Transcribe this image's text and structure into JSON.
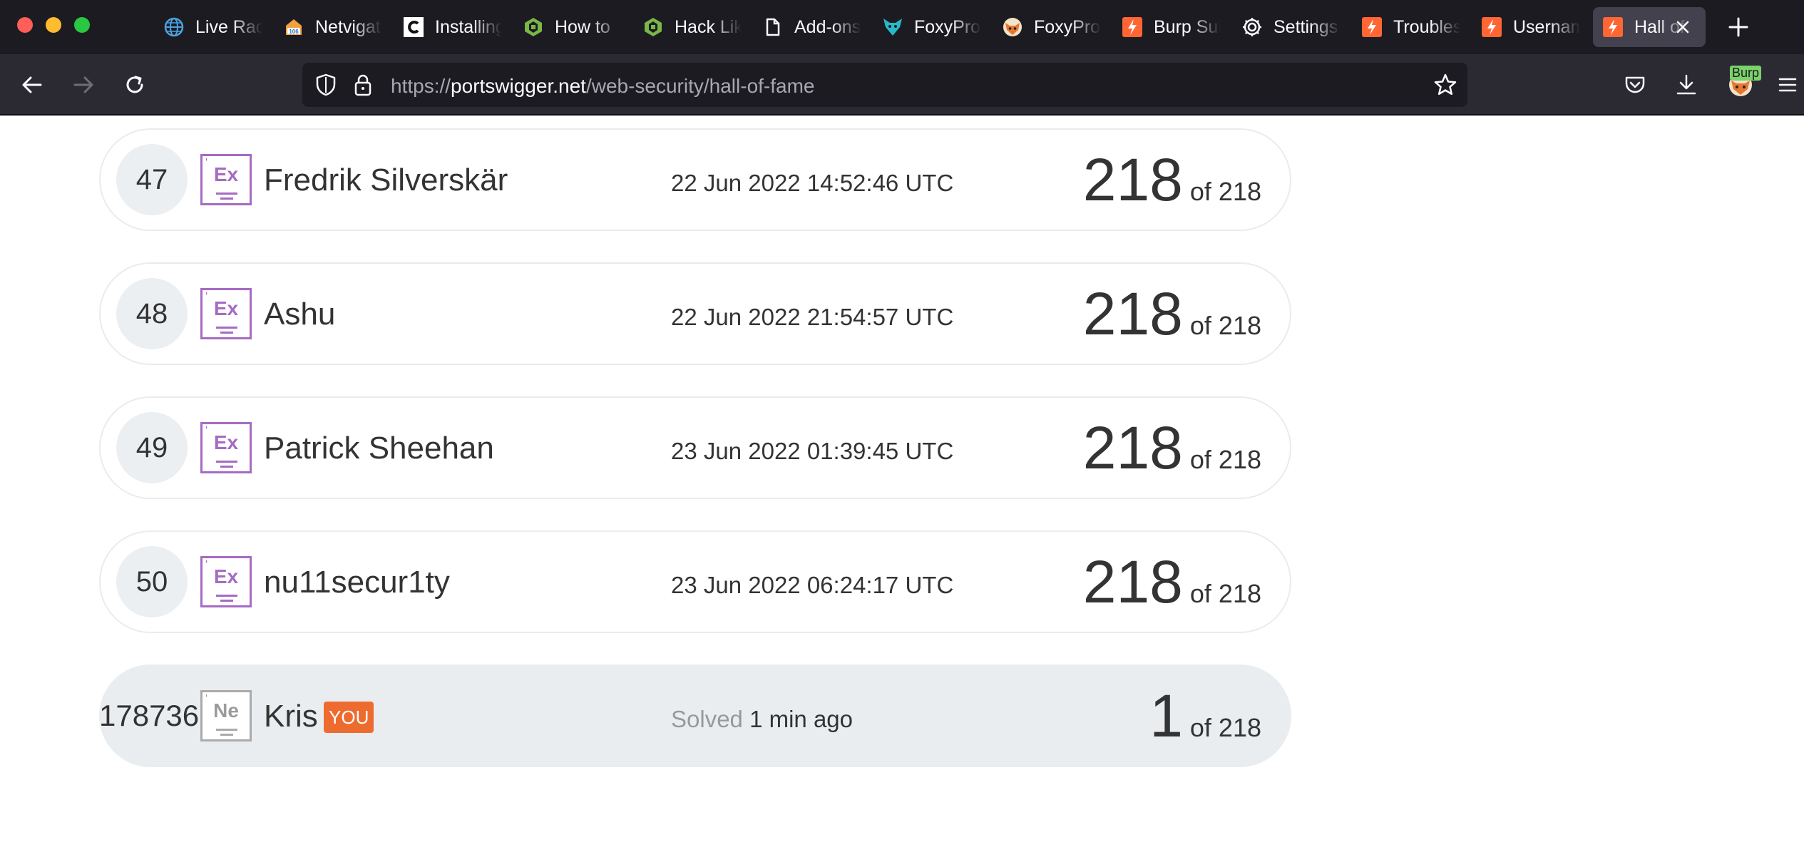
{
  "browser": {
    "tabs": [
      {
        "label": "Live Radar",
        "icon": "globe-icon"
      },
      {
        "label": "Netvigator",
        "icon": "netvigator-icon"
      },
      {
        "label": "Installing",
        "icon": "c-logo-icon"
      },
      {
        "label": "How to",
        "icon": "hack-logo-icon"
      },
      {
        "label": "Hack Like",
        "icon": "hack-logo-icon"
      },
      {
        "label": "Add-ons",
        "icon": "puzzle-icon"
      },
      {
        "label": "FoxyProxy",
        "icon": "foxyproxy-icon"
      },
      {
        "label": "FoxyProxy",
        "icon": "foxyproxy-fox-icon"
      },
      {
        "label": "Burp Suite",
        "icon": "burp-icon"
      },
      {
        "label": "Settings",
        "icon": "gear-icon"
      },
      {
        "label": "Troubleshooting",
        "icon": "burp-icon"
      },
      {
        "label": "Username",
        "icon": "burp-icon"
      },
      {
        "label": "Hall of Fame",
        "icon": "burp-icon"
      }
    ],
    "url": {
      "scheme": "https://",
      "host": "portswigger.net",
      "path": "/web-security/hall-of-fame"
    },
    "extension_label": "Burp"
  },
  "rows": [
    {
      "rank": "47",
      "level": "Ex",
      "name": "Fredrik Silverskär",
      "date": "22 Jun 2022 14:52:46 UTC",
      "score": "218",
      "total": "of 218"
    },
    {
      "rank": "48",
      "level": "Ex",
      "name": "Ashu",
      "date": "22 Jun 2022 21:54:57 UTC",
      "score": "218",
      "total": "of 218"
    },
    {
      "rank": "49",
      "level": "Ex",
      "name": "Patrick Sheehan",
      "date": "23 Jun 2022 01:39:45 UTC",
      "score": "218",
      "total": "of 218"
    },
    {
      "rank": "50",
      "level": "Ex",
      "name": "nu11secur1ty",
      "date": "23 Jun 2022 06:24:17 UTC",
      "score": "218",
      "total": "of 218"
    }
  ],
  "you": {
    "rank": "178736",
    "level": "Ne",
    "name": "Kris",
    "tag": "YOU",
    "solved_label": "Solved",
    "solved_time": "1 min ago",
    "score": "1",
    "total": "of 218"
  },
  "colors": {
    "expert_badge": "#a66bc3",
    "novice_badge": "#aaaaaa",
    "you_tag": "#ee6b2f",
    "accent_burp": "#ff6633"
  }
}
